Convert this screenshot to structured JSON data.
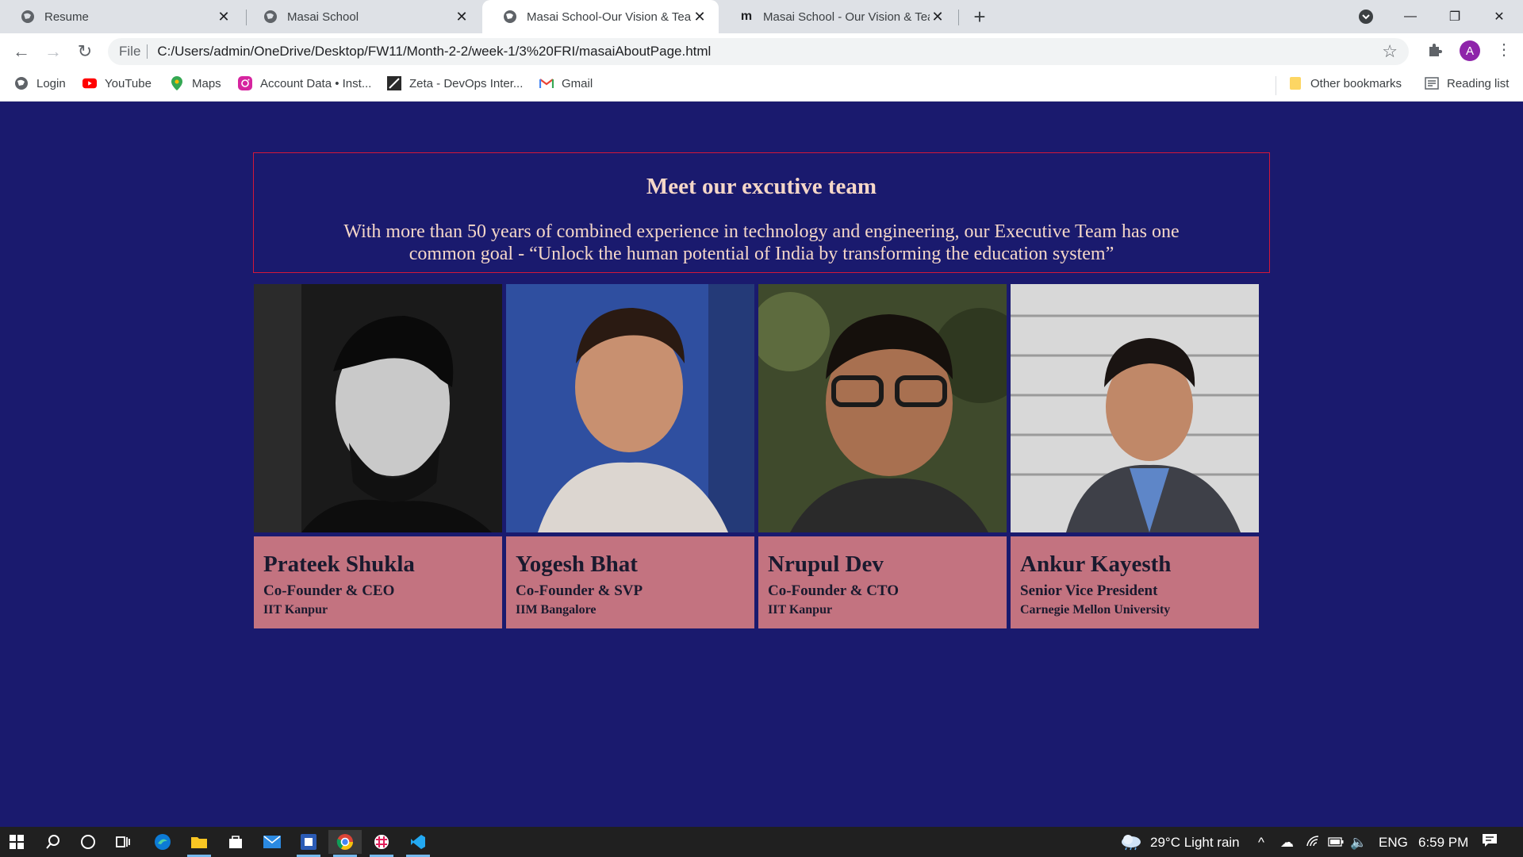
{
  "tabs": [
    {
      "title": "Resume",
      "favicon": "globe-icon"
    },
    {
      "title": "Masai School",
      "favicon": "globe-icon"
    },
    {
      "title": "Masai School-Our Vision & Team",
      "favicon": "globe-icon"
    },
    {
      "title": "Masai School - Our Vision & Tear",
      "favicon": "masai-m-icon"
    }
  ],
  "address": {
    "scheme_label": "File",
    "url": "C:/Users/admin/OneDrive/Desktop/FW11/Month-2-2/week-1/3%20FRI/masaiAboutPage.html"
  },
  "profile_initial": "A",
  "bookmarks": [
    {
      "label": "Login",
      "icon": "globe-icon"
    },
    {
      "label": "YouTube",
      "icon": "youtube-icon"
    },
    {
      "label": "Maps",
      "icon": "maps-pin-icon"
    },
    {
      "label": "Account Data • Inst...",
      "icon": "instagram-icon"
    },
    {
      "label": "Zeta - DevOps Inter...",
      "icon": "zeta-icon"
    },
    {
      "label": "Gmail",
      "icon": "gmail-icon"
    }
  ],
  "bookmarks_right": {
    "other": "Other bookmarks",
    "reading": "Reading list"
  },
  "hero": {
    "heading": "Meet our excutive team",
    "text": "With more than 50 years of combined experience in technology and engineering, our Executive Team has one common goal - “Unlock the human potential of India by transforming the education system”"
  },
  "team": [
    {
      "name": "Prateek Shukla",
      "role": "Co-Founder & CEO",
      "edu": "IIT Kanpur"
    },
    {
      "name": "Yogesh Bhat",
      "role": "Co-Founder & SVP",
      "edu": "IIM Bangalore"
    },
    {
      "name": "Nrupul Dev",
      "role": "Co-Founder & CTO",
      "edu": "IIT Kanpur"
    },
    {
      "name": "Ankur Kayesth",
      "role": "Senior Vice President",
      "edu": "Carnegie Mellon University"
    }
  ],
  "taskbar": {
    "weather": "29°C  Light rain",
    "language": "ENG",
    "time": "6:59 PM"
  },
  "colors": {
    "page_bg": "#1a1a6e",
    "hero_border": "#d3173a",
    "hero_text": "#f5d7c8",
    "card_bg": "#c37380"
  }
}
